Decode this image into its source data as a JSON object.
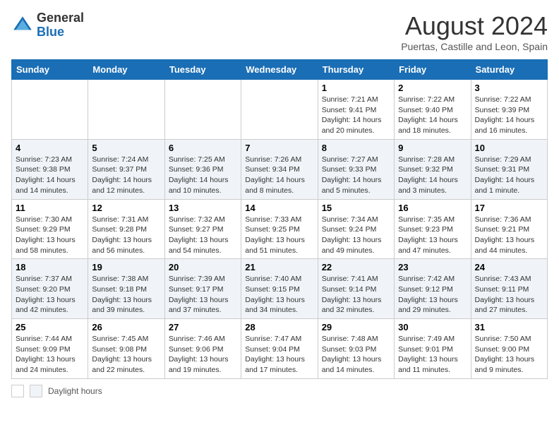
{
  "logo": {
    "general": "General",
    "blue": "Blue"
  },
  "header": {
    "title": "August 2024",
    "subtitle": "Puertas, Castille and Leon, Spain"
  },
  "weekdays": [
    "Sunday",
    "Monday",
    "Tuesday",
    "Wednesday",
    "Thursday",
    "Friday",
    "Saturday"
  ],
  "weeks": [
    [
      {
        "day": "",
        "info": ""
      },
      {
        "day": "",
        "info": ""
      },
      {
        "day": "",
        "info": ""
      },
      {
        "day": "",
        "info": ""
      },
      {
        "day": "1",
        "info": "Sunrise: 7:21 AM\nSunset: 9:41 PM\nDaylight: 14 hours and 20 minutes."
      },
      {
        "day": "2",
        "info": "Sunrise: 7:22 AM\nSunset: 9:40 PM\nDaylight: 14 hours and 18 minutes."
      },
      {
        "day": "3",
        "info": "Sunrise: 7:22 AM\nSunset: 9:39 PM\nDaylight: 14 hours and 16 minutes."
      }
    ],
    [
      {
        "day": "4",
        "info": "Sunrise: 7:23 AM\nSunset: 9:38 PM\nDaylight: 14 hours and 14 minutes."
      },
      {
        "day": "5",
        "info": "Sunrise: 7:24 AM\nSunset: 9:37 PM\nDaylight: 14 hours and 12 minutes."
      },
      {
        "day": "6",
        "info": "Sunrise: 7:25 AM\nSunset: 9:36 PM\nDaylight: 14 hours and 10 minutes."
      },
      {
        "day": "7",
        "info": "Sunrise: 7:26 AM\nSunset: 9:34 PM\nDaylight: 14 hours and 8 minutes."
      },
      {
        "day": "8",
        "info": "Sunrise: 7:27 AM\nSunset: 9:33 PM\nDaylight: 14 hours and 5 minutes."
      },
      {
        "day": "9",
        "info": "Sunrise: 7:28 AM\nSunset: 9:32 PM\nDaylight: 14 hours and 3 minutes."
      },
      {
        "day": "10",
        "info": "Sunrise: 7:29 AM\nSunset: 9:31 PM\nDaylight: 14 hours and 1 minute."
      }
    ],
    [
      {
        "day": "11",
        "info": "Sunrise: 7:30 AM\nSunset: 9:29 PM\nDaylight: 13 hours and 58 minutes."
      },
      {
        "day": "12",
        "info": "Sunrise: 7:31 AM\nSunset: 9:28 PM\nDaylight: 13 hours and 56 minutes."
      },
      {
        "day": "13",
        "info": "Sunrise: 7:32 AM\nSunset: 9:27 PM\nDaylight: 13 hours and 54 minutes."
      },
      {
        "day": "14",
        "info": "Sunrise: 7:33 AM\nSunset: 9:25 PM\nDaylight: 13 hours and 51 minutes."
      },
      {
        "day": "15",
        "info": "Sunrise: 7:34 AM\nSunset: 9:24 PM\nDaylight: 13 hours and 49 minutes."
      },
      {
        "day": "16",
        "info": "Sunrise: 7:35 AM\nSunset: 9:23 PM\nDaylight: 13 hours and 47 minutes."
      },
      {
        "day": "17",
        "info": "Sunrise: 7:36 AM\nSunset: 9:21 PM\nDaylight: 13 hours and 44 minutes."
      }
    ],
    [
      {
        "day": "18",
        "info": "Sunrise: 7:37 AM\nSunset: 9:20 PM\nDaylight: 13 hours and 42 minutes."
      },
      {
        "day": "19",
        "info": "Sunrise: 7:38 AM\nSunset: 9:18 PM\nDaylight: 13 hours and 39 minutes."
      },
      {
        "day": "20",
        "info": "Sunrise: 7:39 AM\nSunset: 9:17 PM\nDaylight: 13 hours and 37 minutes."
      },
      {
        "day": "21",
        "info": "Sunrise: 7:40 AM\nSunset: 9:15 PM\nDaylight: 13 hours and 34 minutes."
      },
      {
        "day": "22",
        "info": "Sunrise: 7:41 AM\nSunset: 9:14 PM\nDaylight: 13 hours and 32 minutes."
      },
      {
        "day": "23",
        "info": "Sunrise: 7:42 AM\nSunset: 9:12 PM\nDaylight: 13 hours and 29 minutes."
      },
      {
        "day": "24",
        "info": "Sunrise: 7:43 AM\nSunset: 9:11 PM\nDaylight: 13 hours and 27 minutes."
      }
    ],
    [
      {
        "day": "25",
        "info": "Sunrise: 7:44 AM\nSunset: 9:09 PM\nDaylight: 13 hours and 24 minutes."
      },
      {
        "day": "26",
        "info": "Sunrise: 7:45 AM\nSunset: 9:08 PM\nDaylight: 13 hours and 22 minutes."
      },
      {
        "day": "27",
        "info": "Sunrise: 7:46 AM\nSunset: 9:06 PM\nDaylight: 13 hours and 19 minutes."
      },
      {
        "day": "28",
        "info": "Sunrise: 7:47 AM\nSunset: 9:04 PM\nDaylight: 13 hours and 17 minutes."
      },
      {
        "day": "29",
        "info": "Sunrise: 7:48 AM\nSunset: 9:03 PM\nDaylight: 13 hours and 14 minutes."
      },
      {
        "day": "30",
        "info": "Sunrise: 7:49 AM\nSunset: 9:01 PM\nDaylight: 13 hours and 11 minutes."
      },
      {
        "day": "31",
        "info": "Sunrise: 7:50 AM\nSunset: 9:00 PM\nDaylight: 13 hours and 9 minutes."
      }
    ]
  ],
  "legend": {
    "daylight_label": "Daylight hours"
  }
}
